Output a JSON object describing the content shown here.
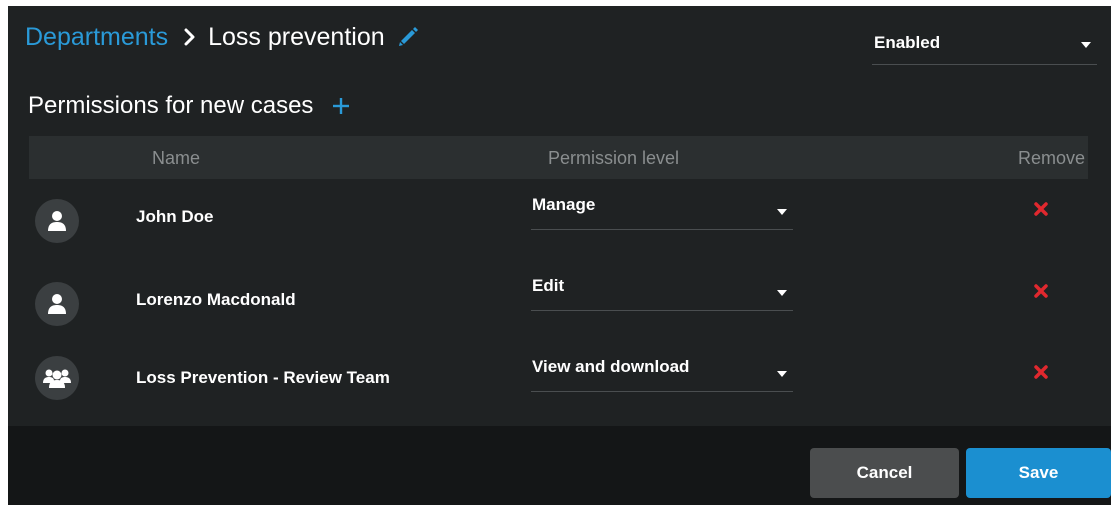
{
  "breadcrumb": {
    "parent": "Departments",
    "current": "Loss prevention"
  },
  "status": {
    "value": "Enabled"
  },
  "permissions": {
    "title": "Permissions for new cases",
    "columns": {
      "name": "Name",
      "permission_level": "Permission level",
      "remove": "Remove"
    },
    "rows": [
      {
        "name": "John Doe",
        "type": "user",
        "permission": "Manage",
        "icon": "user-icon"
      },
      {
        "name": "Lorenzo Macdonald",
        "type": "user",
        "permission": "Edit",
        "icon": "user-icon"
      },
      {
        "name": "Loss Prevention - Review Team",
        "type": "group",
        "permission": "View and download",
        "icon": "group-icon"
      }
    ]
  },
  "footer": {
    "cancel_label": "Cancel",
    "save_label": "Save"
  },
  "colors": {
    "background": "#1f2223",
    "header_row": "#2b2f30",
    "footer": "#141617",
    "accent_blue": "#1b8fd0",
    "link_blue": "#2a9ad8",
    "remove_red": "#e0282e"
  }
}
